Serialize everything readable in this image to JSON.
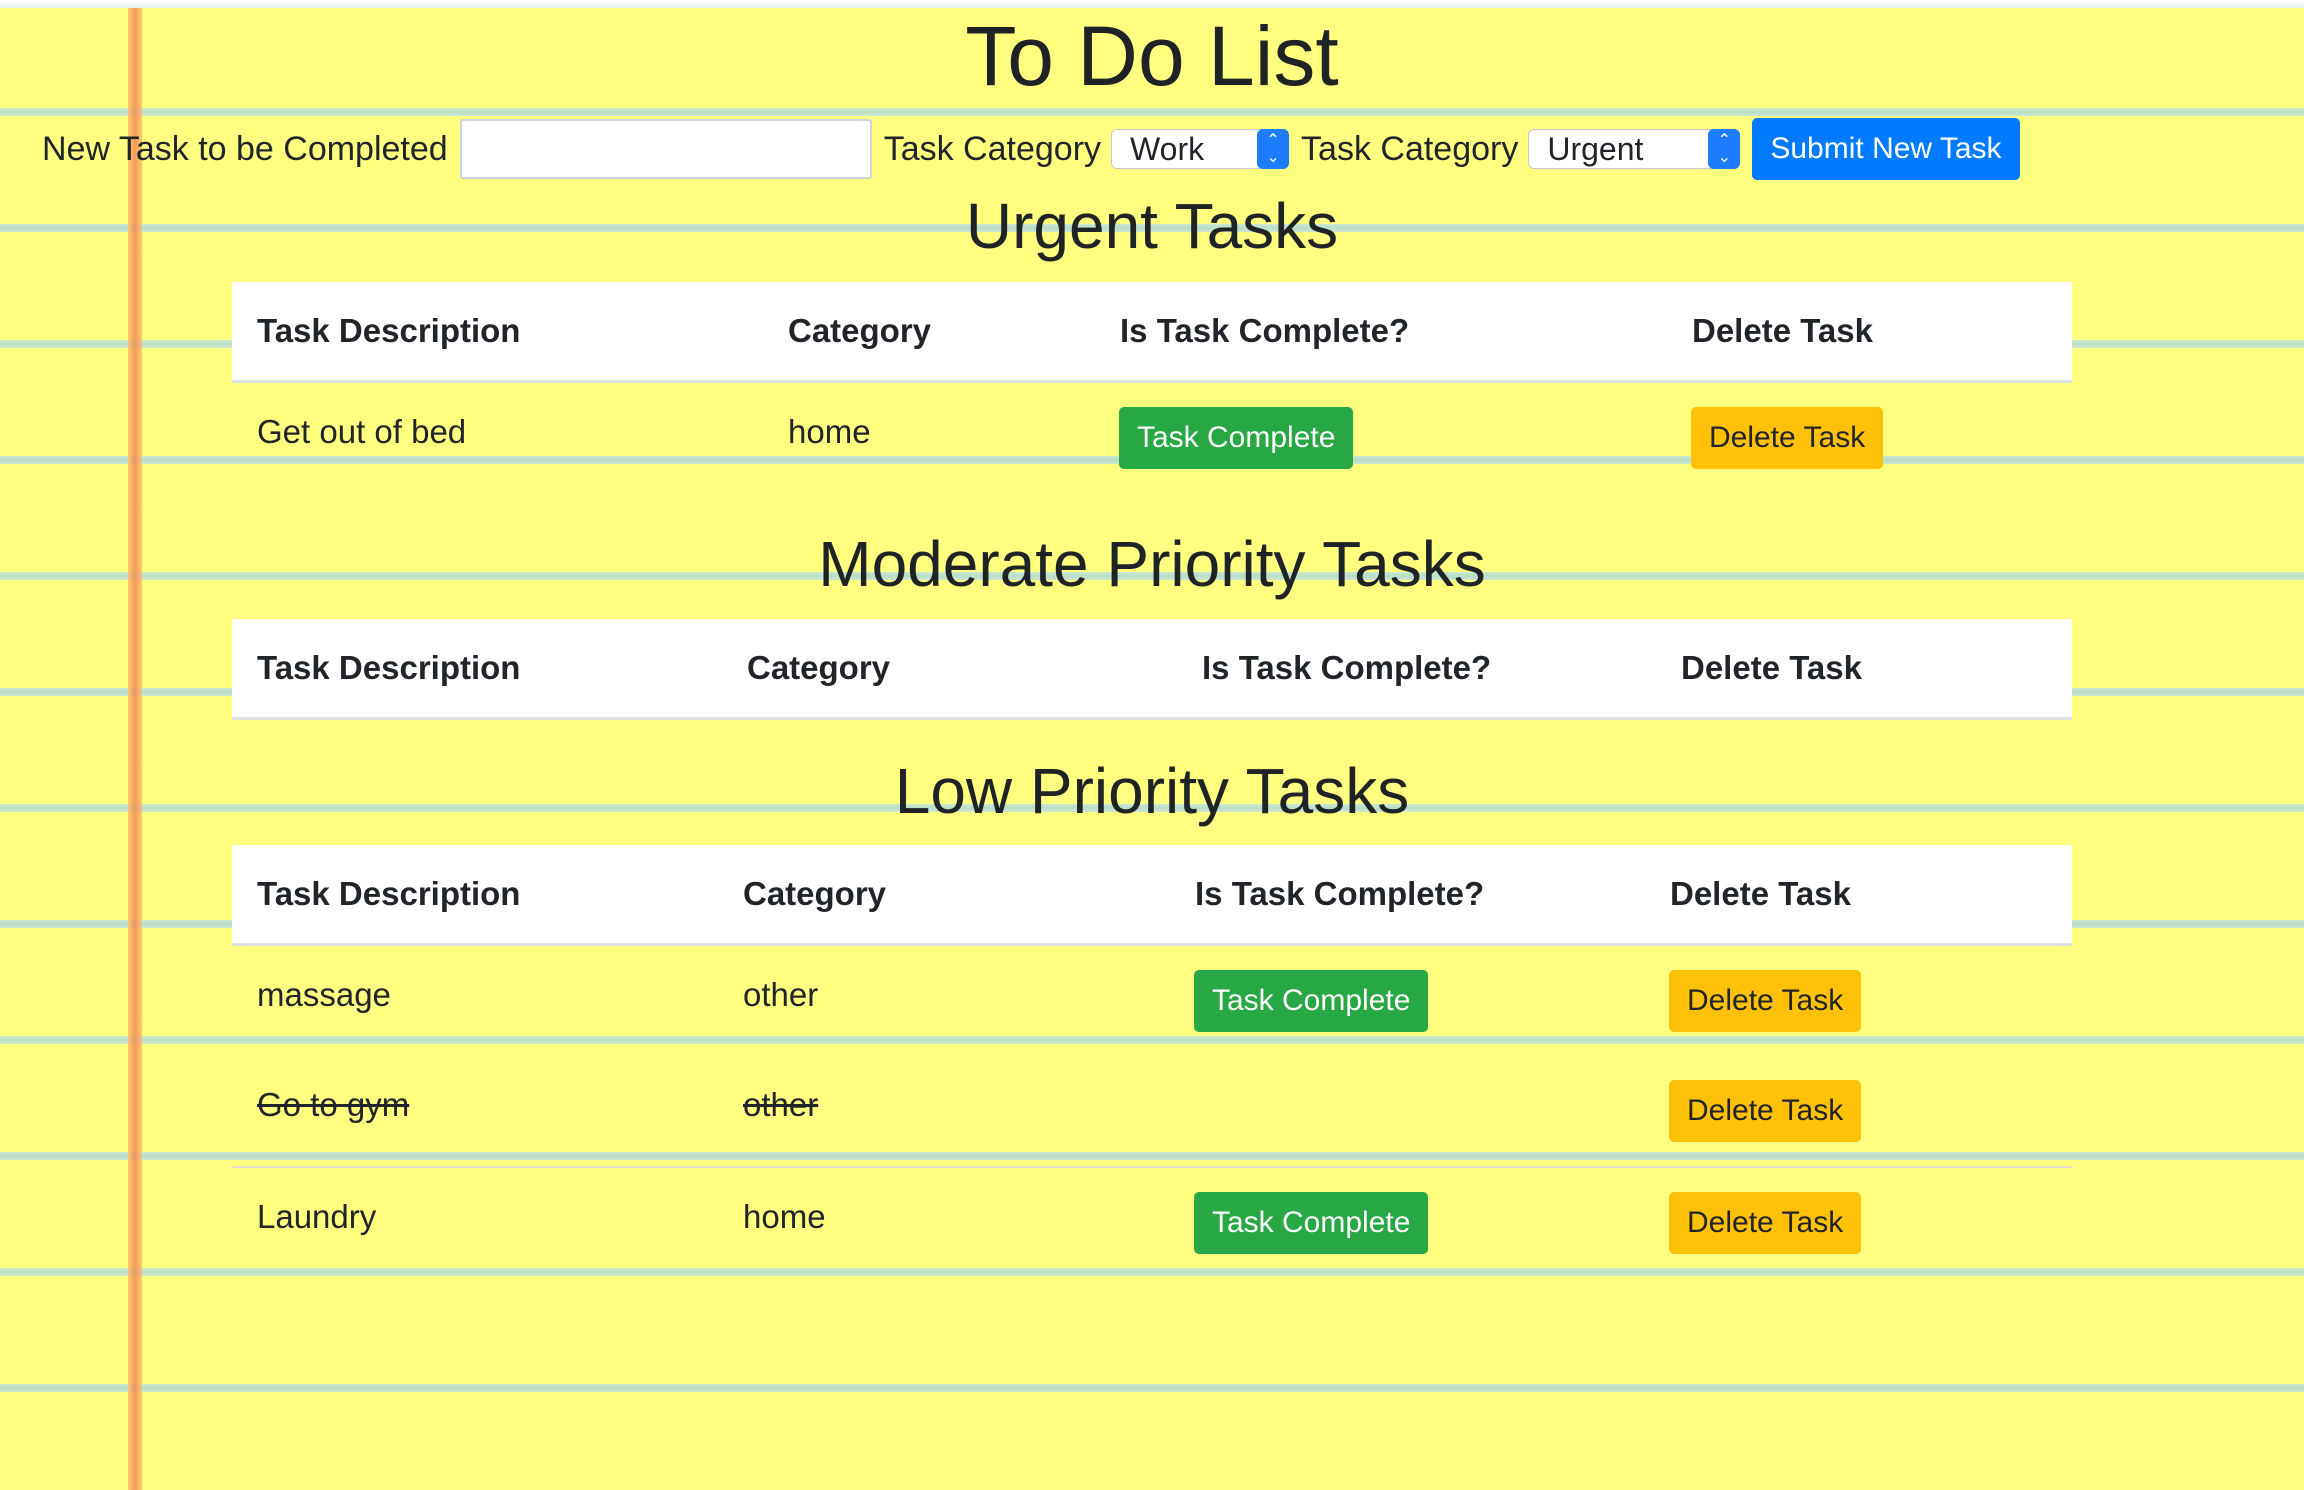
{
  "page": {
    "title": "To Do List",
    "colors": {
      "paper": "#ffff80",
      "primary": "#007bff",
      "success": "#28a745",
      "warning": "#ffc107"
    }
  },
  "form": {
    "task_label": "New Task to be Completed",
    "task_value": "",
    "category_label_1": "Task Category",
    "category_value_1": "Work",
    "category_label_2": "Task Category",
    "category_value_2": "Urgent",
    "submit_label": "Submit New Task",
    "select_icon": "chevron-updown-icon"
  },
  "urgent": {
    "title": "Urgent Tasks",
    "headers": [
      "Task Description",
      "Category",
      "Is Task Complete?",
      "Delete Task"
    ],
    "rows": [
      {
        "description": "Get out of bed",
        "category": "home",
        "complete_label": "Task Complete",
        "delete_label": "Delete Task"
      }
    ]
  },
  "moderate": {
    "title": "Moderate Priority Tasks",
    "headers": [
      "Task Description",
      "Category",
      "Is Task Complete?",
      "Delete Task"
    ],
    "rows": []
  },
  "low": {
    "title": "Low Priority Tasks",
    "headers": [
      "Task Description",
      "Category",
      "Is Task Complete?",
      "Delete Task"
    ],
    "rows": [
      {
        "description": "massage",
        "category": "other",
        "complete_label": "Task Complete",
        "delete_label": "Delete Task",
        "completed": false
      },
      {
        "description": "Go to gym",
        "category": "other",
        "delete_label": "Delete Task",
        "completed": true
      },
      {
        "description": "Laundry",
        "category": "home",
        "complete_label": "Task Complete",
        "delete_label": "Delete Task",
        "completed": false
      }
    ]
  }
}
